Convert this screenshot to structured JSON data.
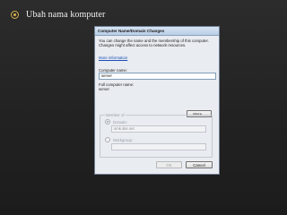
{
  "slide": {
    "bullet_text": "Ubah nama komputer"
  },
  "dialog": {
    "title": "Computer Name/Domain Changes",
    "description": "You can change the name and the membership of this computer. Changes might affect access to network resources.",
    "more_info_link": "More information",
    "computer_name_label": "Computer name:",
    "computer_name_value": "server",
    "full_name_label": "Full computer name:",
    "full_name_value": "server",
    "more_button": "More...",
    "member_of": {
      "legend": "Member of",
      "domain_label": "Domain:",
      "domain_value": "smk.sks.net",
      "workgroup_label": "Workgroup:",
      "workgroup_value": ""
    },
    "ok_button": "OK",
    "cancel_button": "Cancel"
  },
  "colors": {
    "background": "#262626",
    "bullet": "#d8b24a",
    "dialog_bg": "#e9ecf1",
    "link": "#1a4fb5"
  }
}
